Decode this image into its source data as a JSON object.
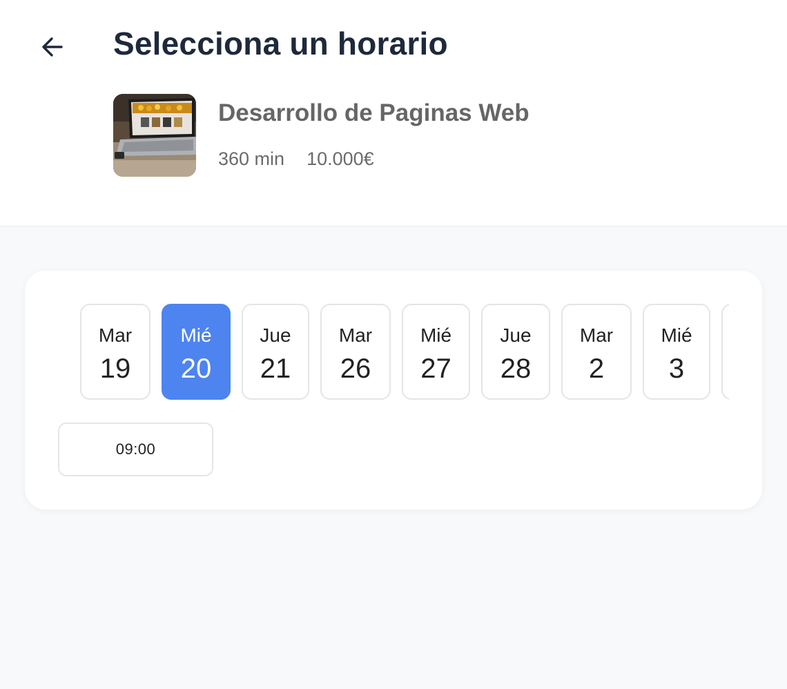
{
  "header": {
    "title": "Selecciona un horario",
    "back_icon": "arrow-left-icon"
  },
  "service": {
    "name": "Desarrollo de Paginas Web",
    "duration": "360 min",
    "price": "10.000€",
    "thumbnail": "laptop-photo"
  },
  "colors": {
    "accent": "#4d84ef",
    "title": "#1e293b",
    "muted": "#666666",
    "background": "#f8f9fb"
  },
  "dates": [
    {
      "dow": "Mar",
      "day": "19",
      "selected": false
    },
    {
      "dow": "Mié",
      "day": "20",
      "selected": true
    },
    {
      "dow": "Jue",
      "day": "21",
      "selected": false
    },
    {
      "dow": "Mar",
      "day": "26",
      "selected": false
    },
    {
      "dow": "Mié",
      "day": "27",
      "selected": false
    },
    {
      "dow": "Jue",
      "day": "28",
      "selected": false
    },
    {
      "dow": "Mar",
      "day": "2",
      "selected": false
    },
    {
      "dow": "Mié",
      "day": "3",
      "selected": false
    }
  ],
  "times": [
    "09:00"
  ]
}
